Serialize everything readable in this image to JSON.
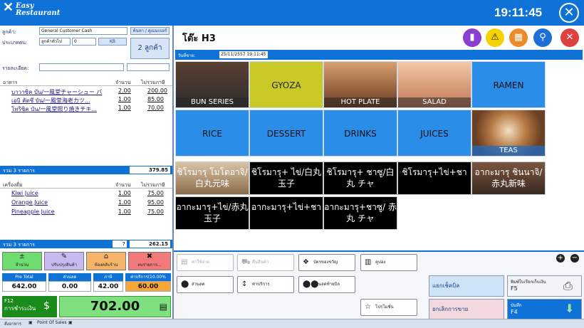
{
  "app": {
    "logo_line1": "Easy",
    "logo_line2": "Restaurant",
    "clock": "19:11:45"
  },
  "customer": {
    "label": "ลูกค้า:",
    "value": "General Customer Cash",
    "search_btn": "ค้นหา / ดูเมมเบอร์",
    "type_label": "ประเภทคน:",
    "type_value": "ลูกค้าทั่วไป",
    "count_value": "0",
    "kb_btn": "KB",
    "guests_btn": "2 ลูกค้า",
    "detail_label": "รายละเอียด:"
  },
  "food": {
    "header_name": "อาหาร",
    "header_qty": "จำนวน",
    "header_price": "ไม่รวมภาษี",
    "items": [
      {
        "name": "บาวาซิค บัน/一風堂チャーシュー バ",
        "qty": "2.00",
        "price": "200.00"
      },
      {
        "name": "เอบิ คัตซึ บัน/一風堂海老カツ...",
        "qty": "1.00",
        "price": "85.00"
      },
      {
        "name": "โทริซิค บัน/一風堂照り焼きチキ...",
        "qty": "1.00",
        "price": "70.00"
      }
    ],
    "summary_label": "รวม 3 รายการ",
    "summary_total": "379.85"
  },
  "drinks": {
    "header_name": "เครื่องดื่ม",
    "header_qty": "จำนวน",
    "header_price": "ไม่รวมภาษี",
    "items": [
      {
        "name": "Kiwi Juice",
        "qty": "1.00",
        "price": "75.00"
      },
      {
        "name": "Orange Juice",
        "qty": "1.00",
        "price": "95.00"
      },
      {
        "name": "Pineapple Juice",
        "qty": "1.00",
        "price": "75.00"
      }
    ],
    "summary_label": "รวม 3 รายการ",
    "summary_count": "7",
    "summary_total": "262.15"
  },
  "actions": {
    "qty": "จำนวน",
    "update": "ปรับปรุงสินค้า",
    "room": "ห้องคลับร้าน",
    "cancel": "ลบรายการ..."
  },
  "totals": {
    "pre_total_label": "Pre Total",
    "pre_total": "642.00",
    "discount_label": "ส่วนลด",
    "discount": "0.00",
    "tax_label": "ภาษี",
    "tax": "42.00",
    "service_label": "ค่าบริการ(10.00%",
    "service": "60.00"
  },
  "pay": {
    "key": "F12",
    "label": "การชำระเงิน",
    "amount": "702.00"
  },
  "table": {
    "title": "โต๊ะ H3",
    "date_label": "วันที่ขาย:",
    "date_value": "25/11/2557 19:11:45"
  },
  "categories": [
    {
      "label": "BUN SERIES"
    },
    {
      "label": "GYOZA"
    },
    {
      "label": "HOT PLATE"
    },
    {
      "label": "SALAD"
    },
    {
      "label": "RAMEN"
    },
    {
      "label": "RICE"
    },
    {
      "label": "DESSERT"
    },
    {
      "label": "DRINKS"
    },
    {
      "label": "JUICES"
    },
    {
      "label": "TEAS"
    }
  ],
  "dishes": [
    {
      "label": "ชิโรมารุ โมโตอาจิ/白丸元味"
    },
    {
      "label": "ชิโรมารุ+ ไข่/白丸玉子"
    },
    {
      "label": "ชิโรมารุ+ ชาซู/白 丸 チャ"
    },
    {
      "label": "ชิโรมารุ+ไข่+ชา"
    },
    {
      "label": "อากะมารุ ชินนาจิ/赤丸新味"
    },
    {
      "label": "อากะมารุ+ไข่/赤丸玉子"
    },
    {
      "label": "อากะมารุ+ไข่+ชา"
    },
    {
      "label": "อากะมารุ+ชาซู/ 赤 丸 チャ"
    }
  ],
  "functions": {
    "f1": "ค่าใช้จ่าย",
    "f2": "คืนสินค้า",
    "f3": "บัตรของขวัญ",
    "f4": "คูปอง",
    "f5": "ส่วนลด",
    "f6": "ค่าบริการ",
    "f7": "ส่วนลดท้ายบิล",
    "f8": "โปรโมชั่น",
    "split_bill": "แยกเช็คบิล",
    "cancel_sale": "ยกเลิกการขาย",
    "print_label": "พิมพ์ใบเรียกเก็บเงิน",
    "print_key": "F5",
    "save_label": "บันทึก",
    "save_key": "F4"
  },
  "status": {
    "item1": "สั่งอาหาร",
    "item2": "Point Of Sales"
  }
}
